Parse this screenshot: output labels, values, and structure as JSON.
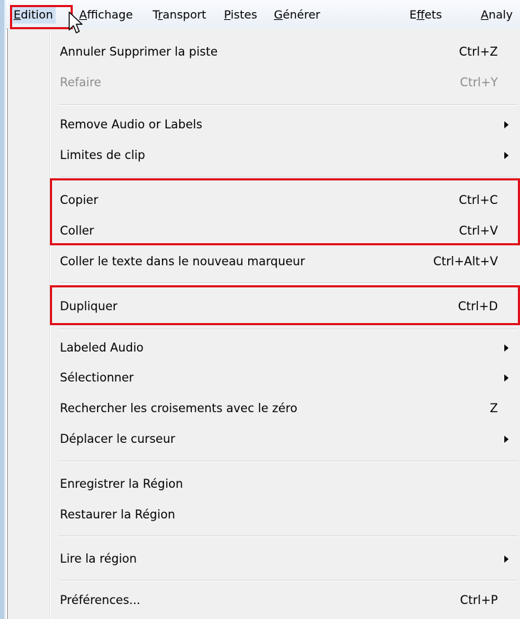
{
  "menubar": {
    "items": [
      {
        "before": "",
        "mnemonic": "E",
        "after": "dition"
      },
      {
        "before": "",
        "mnemonic": "A",
        "after": "ffichage"
      },
      {
        "before": "T",
        "mnemonic": "r",
        "after": "ansport"
      },
      {
        "before": "",
        "mnemonic": "P",
        "after": "istes"
      },
      {
        "before": "",
        "mnemonic": "G",
        "after": "énérer"
      },
      {
        "before": "E",
        "mnemonic": "f",
        "after": "fets"
      },
      {
        "before": "",
        "mnemonic": "A",
        "after": "naly"
      }
    ]
  },
  "menu": {
    "undo": {
      "label": "Annuler Supprimer la piste",
      "shortcut": "Ctrl+Z"
    },
    "redo": {
      "label": "Refaire",
      "shortcut": "Ctrl+Y"
    },
    "remove_audio": {
      "label": "Remove Audio or Labels"
    },
    "clip_limits": {
      "label": "Limites de clip"
    },
    "copy": {
      "label": "Copier",
      "shortcut": "Ctrl+C"
    },
    "paste": {
      "label": "Coller",
      "shortcut": "Ctrl+V"
    },
    "paste_text": {
      "label": "Coller le texte dans le nouveau marqueur",
      "shortcut": "Ctrl+Alt+V"
    },
    "duplicate": {
      "label": "Dupliquer",
      "shortcut": "Ctrl+D"
    },
    "labeled_audio": {
      "label": "Labeled Audio"
    },
    "select": {
      "label": "Sélectionner"
    },
    "zero_crossing": {
      "label": "Rechercher les croisements avec le zéro",
      "shortcut": "Z"
    },
    "move_cursor": {
      "label": "Déplacer le curseur"
    },
    "save_region": {
      "label": "Enregistrer la Région"
    },
    "restore_region": {
      "label": "Restaurer la Région"
    },
    "play_region": {
      "label": "Lire la région"
    },
    "preferences": {
      "label": "Préférences...",
      "shortcut": "Ctrl+P"
    }
  },
  "colors": {
    "highlight": "#e0101a",
    "menu_bg": "#f0f0f0",
    "disabled_text": "#8d8d8d"
  }
}
